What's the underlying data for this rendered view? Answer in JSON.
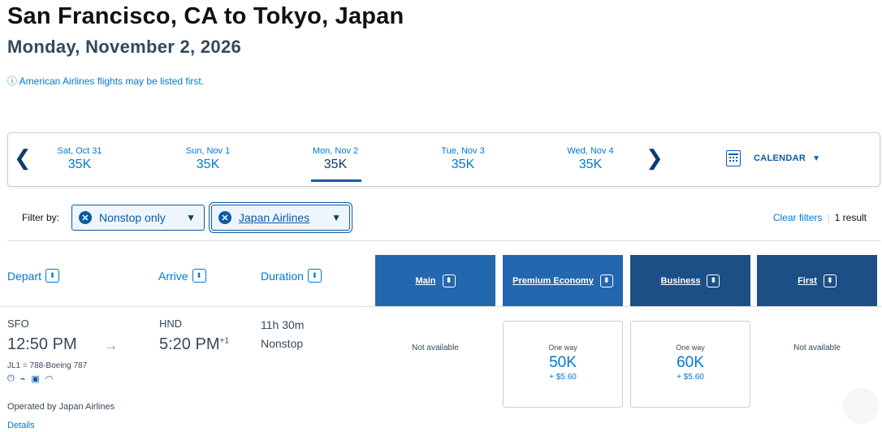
{
  "page": {
    "title": "San Francisco, CA to Tokyo, Japan",
    "subtitle": "Monday, November 2, 2026",
    "notice": "ⓘ American Airlines flights may be listed first."
  },
  "date_strip": {
    "prev_arrow": "❮",
    "next_arrow": "❯",
    "days": [
      {
        "label": "Sat, Oct 31",
        "price": "35K"
      },
      {
        "label": "Sun, Nov 1",
        "price": "35K"
      },
      {
        "label": "Mon, Nov 2",
        "price": "35K",
        "selected": true
      },
      {
        "label": "Tue, Nov 3",
        "price": "35K"
      },
      {
        "label": "Wed, Nov 4",
        "price": "35K"
      }
    ],
    "calendar_label": "CALENDAR",
    "calendar_caret": "▼"
  },
  "filters": {
    "label": "Filter by:",
    "chips": [
      {
        "text": "Nonstop only",
        "remove": "✕",
        "caret": "▼"
      },
      {
        "text": "Japan Airlines",
        "remove": "✕",
        "caret": "▼"
      }
    ],
    "clear": "Clear filters",
    "separator": "|",
    "result_count": "1 result"
  },
  "columns": {
    "depart": "Depart",
    "arrive": "Arrive",
    "duration": "Duration",
    "sort_glyph": "⬍",
    "cabins": [
      "Main",
      "Premium Economy",
      "Business",
      "First"
    ]
  },
  "flight": {
    "depart_code": "SFO",
    "depart_time": "12:50 PM",
    "arrow": "→",
    "arrive_code": "HND",
    "arrive_time": "5:20 PM",
    "arrive_day_offset": "+1",
    "flight_number": "JL1",
    "flight_sep": "≡",
    "aircraft": "788-Boeing 787",
    "amenities_icons": [
      "power-outlet-icon",
      "usb-icon",
      "entertainment-icon",
      "wifi-icon"
    ],
    "amenities_glyphs": [
      "⏻",
      "⌁",
      "▣",
      "◠"
    ],
    "operated_by": "Operated by Japan Airlines",
    "details_link": "Details",
    "duration": "11h 30m",
    "stops": "Nonstop",
    "fares": {
      "main": "Not available",
      "premium_economy": {
        "type": "One way",
        "points": "50K",
        "tax": "+ $5.60"
      },
      "business": {
        "type": "One way",
        "points": "60K",
        "tax": "+ $5.60"
      },
      "first": "Not available"
    }
  },
  "colors": {
    "link_blue": "#0078d2",
    "navy": "#0b3c73",
    "cabin_main": "#2367af",
    "cabin_premium": "#1b4f86"
  }
}
